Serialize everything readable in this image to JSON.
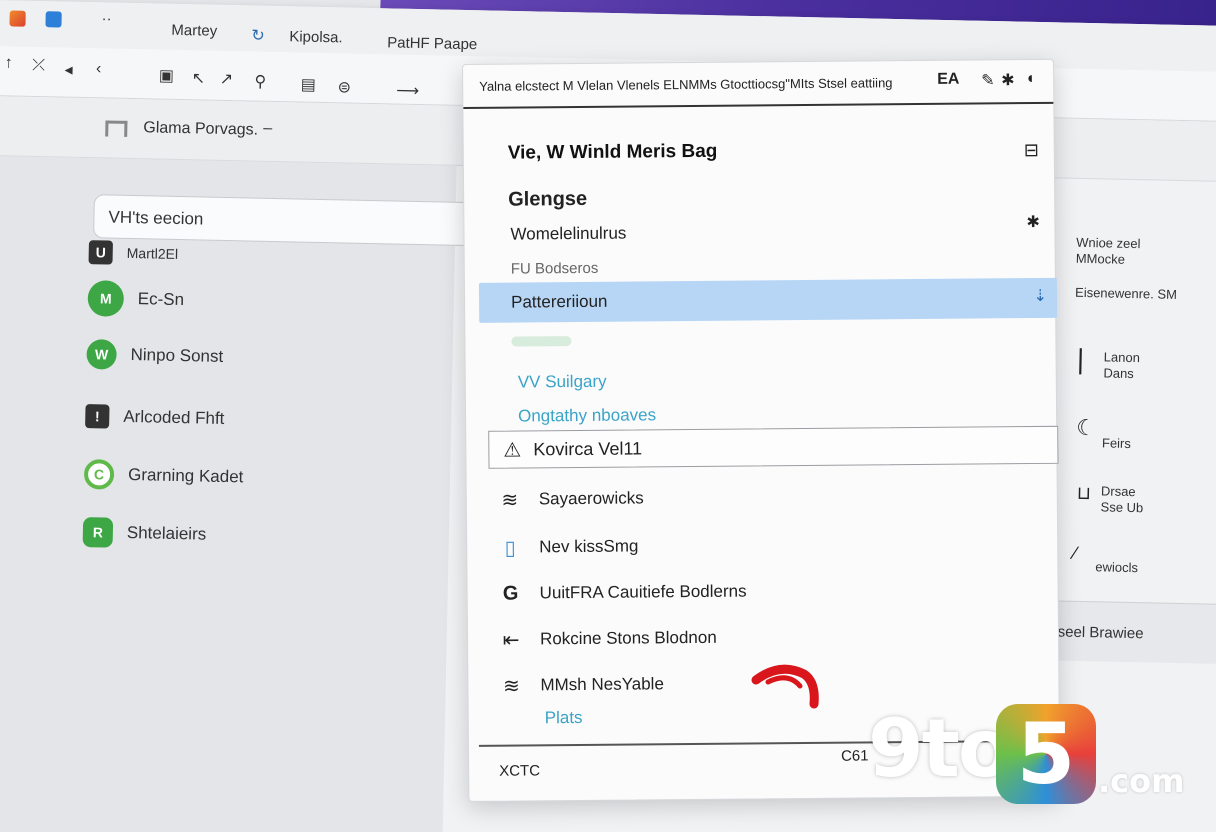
{
  "tabbar": {
    "app_icons": [
      "orange-app-icon",
      "blue-app-icon"
    ],
    "overflow": "··",
    "tabs": [
      {
        "label": "Martey"
      },
      {
        "label": "Kipolsa."
      },
      {
        "label": "PatHF Paape"
      }
    ]
  },
  "toolbar": {
    "buttons": [
      "↑",
      "⤫",
      "◂",
      "‹",
      "▣",
      "↖",
      "↗",
      "⚲",
      "▤",
      "⊜",
      "⟶"
    ]
  },
  "subheader": {
    "title": "Glama Porvags.",
    "dash": "–"
  },
  "left_panel": {
    "search_value": "VH'ts eecion",
    "items": [
      {
        "label": "Martl2El",
        "icon": "U",
        "color": "#333333"
      },
      {
        "label": "Ec-Sn",
        "icon": "M",
        "color": "#3ca744"
      },
      {
        "label": "Ninpo Sonst",
        "icon": "W",
        "color": "#3ca744"
      },
      {
        "label": "Arlcoded Fhft",
        "icon": "!",
        "color": "#333333"
      },
      {
        "label": "Grarning Kadet",
        "icon": "C",
        "color": "#5fba4a"
      },
      {
        "label": "Shtelaieirs",
        "icon": "R",
        "color": "#3ca744"
      }
    ]
  },
  "right_panel": {
    "lines": [
      {
        "text": "Wnioe zeel\nMMocke"
      },
      {
        "text": "Eisenewenre. SM"
      },
      {
        "text": "Lanon\nDans"
      },
      {
        "text": "Feirs"
      },
      {
        "text": "Drsae\nSse Ub"
      },
      {
        "text": "ewiocls"
      }
    ],
    "footer": "Isseel Brawiee"
  },
  "menu": {
    "top_text": "Yalna elcstect M Vlelan Vlenels ELNMMs Gtocttiocsg\"MIts Stsel eattiing",
    "top_icons": [
      "EA",
      "✎",
      "✱",
      "◖"
    ],
    "heading": "Vie, W Winld Meris Bag",
    "heading_icon": "⊟",
    "section": "Glengse",
    "item1": "Womelelinulrus",
    "item1_icon": "✱",
    "item2": "FU Bodseros",
    "highlight": "Pattereriioun",
    "highlight_icon": "⇣",
    "link1": "VV Suilgary",
    "link2": "Ongtathy nboaves",
    "selected": "Kovirca Vel11",
    "selected_icon": "⚠",
    "rows": [
      {
        "icon": "≋",
        "label": "Sayaerowicks"
      },
      {
        "icon": "▯",
        "label": "Nev kissSmg"
      },
      {
        "icon": "G",
        "label": "UuitFRA Cauitiefe Bodlerns"
      },
      {
        "icon": "⇤",
        "label": "Rokcine Stons Blodnon"
      },
      {
        "icon": "≋",
        "label": "MMsh NesYable"
      }
    ],
    "link3": "Plats",
    "footer_left": "XCTC",
    "footer_right": "C61"
  },
  "watermark": {
    "part1": "9to",
    "part2": "5",
    "part3": ".com"
  },
  "colors": {
    "highlight": "#b7d6f6",
    "link": "#3aa3c8",
    "wallpaper": "#4a2f9e",
    "accent_green": "#3ca744"
  }
}
